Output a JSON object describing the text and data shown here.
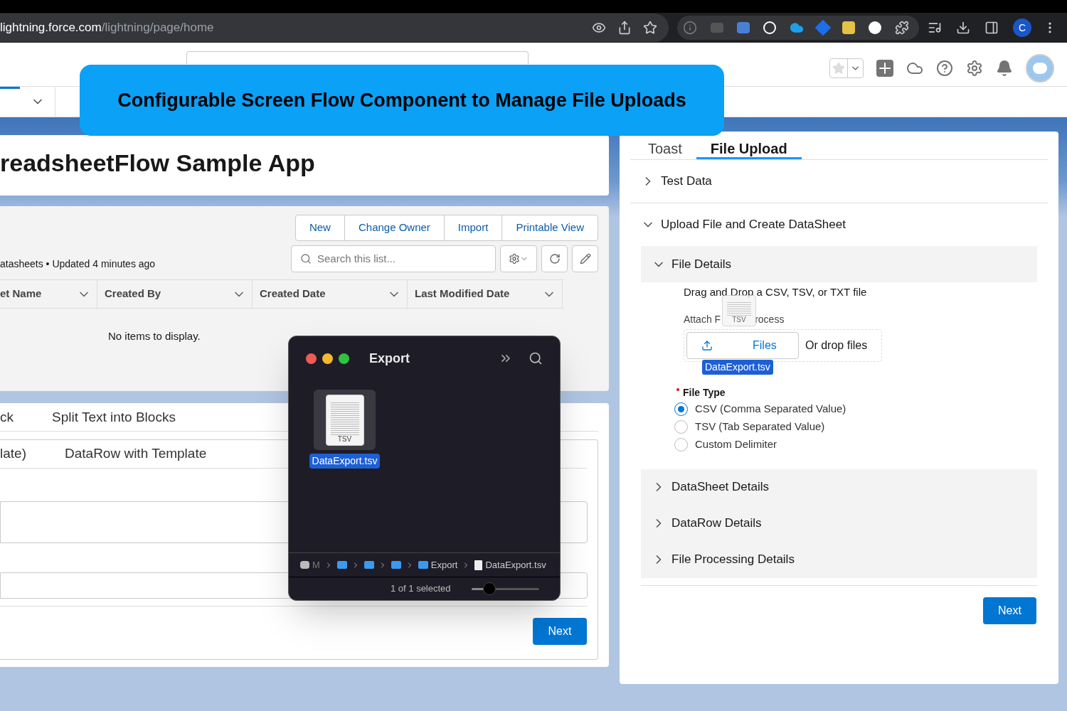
{
  "browser": {
    "url_host": "lightning.force.com",
    "url_path": "/lightning/page/home",
    "profile_initial": "C"
  },
  "banner": {
    "title": "Configurable Screen Flow Component to Manage File Uploads"
  },
  "app_title": "readsheetFlow Sample App",
  "list": {
    "buttons": [
      "New",
      "Change Owner",
      "Import",
      "Printable View"
    ],
    "search_placeholder": "Search this list...",
    "summary": "atasheets • Updated 4 minutes ago",
    "columns": [
      "et Name",
      "Created By",
      "Created Date",
      "Last Modified Date"
    ],
    "empty_message": "No items to display."
  },
  "flow_left": {
    "rows": [
      {
        "column_1": "ck",
        "column_2": "Split Text into Blocks"
      },
      {
        "column_1": "late)",
        "column_2": "DataRow with Template"
      }
    ],
    "next_label": "Next"
  },
  "finder": {
    "title": "Export",
    "file": {
      "name": "DataExport.tsv",
      "badge": "TSV",
      "selected": true
    },
    "path": [
      {
        "kind": "disk",
        "label": "M"
      },
      {
        "kind": "folder"
      },
      {
        "kind": "folder"
      },
      {
        "kind": "folder"
      },
      {
        "kind": "folder",
        "label": "Export"
      },
      {
        "kind": "file",
        "label": "DataExport.tsv"
      }
    ],
    "status": "1 of 1 selected",
    "zoom": {
      "level": 0.27
    }
  },
  "panel": {
    "tabs": [
      {
        "label": "Toast",
        "selected": false
      },
      {
        "label": "File Upload",
        "selected": true
      }
    ],
    "sections": [
      {
        "title": "Test Data",
        "expanded": false
      },
      {
        "title": "Upload File and Create DataSheet",
        "expanded": true,
        "subsections": [
          {
            "title": "File Details",
            "expanded": true
          },
          {
            "title": "DataSheet Details",
            "expanded": false
          },
          {
            "title": "DataRow Details",
            "expanded": false
          },
          {
            "title": "File Processing Details",
            "expanded": false
          }
        ]
      }
    ],
    "file_details": {
      "instructions": "Drag and Drop a CSV, TSV, or TXT file",
      "label_start": "Attach F",
      "label_end": "rocess",
      "button_label": "Files",
      "drop_label": "Or drop files",
      "dragged_file": {
        "name": "DataExport.tsv",
        "badge": "TSV"
      },
      "file_type": {
        "label": "File Type",
        "required": true,
        "options": [
          {
            "label": "CSV (Comma Separated Value)",
            "selected": true
          },
          {
            "label": "TSV (Tab Separated Value)",
            "selected": false
          },
          {
            "label": "Custom Delimiter",
            "selected": false
          }
        ]
      }
    },
    "next_label": "Next"
  }
}
